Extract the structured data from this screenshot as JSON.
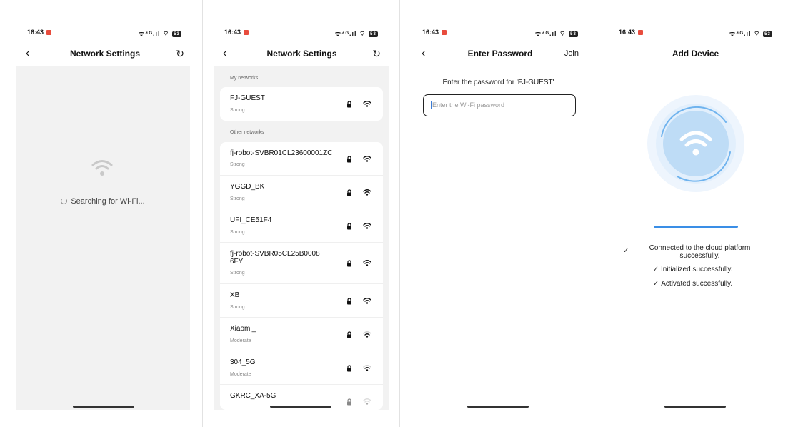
{
  "status_bar": {
    "time": "16:43",
    "system_icons": "ᯤ⁴ᴳ.ıl ⌔",
    "battery": "53"
  },
  "screen1": {
    "title": "Network Settings",
    "back_icon": "‹",
    "refresh_icon": "↻",
    "searching_text": "Searching for Wi-Fi..."
  },
  "screen2": {
    "title": "Network Settings",
    "back_icon": "‹",
    "refresh_icon": "↻",
    "my_networks_label": "My networks",
    "other_networks_label": "Other networks",
    "my_networks": [
      {
        "name": "FJ-GUEST",
        "strength": "Strong"
      }
    ],
    "other_networks": [
      {
        "name": "fj-robot-SVBR01CL23600001ZC",
        "strength": "Strong"
      },
      {
        "name": "YGGD_BK",
        "strength": "Strong"
      },
      {
        "name": "UFI_CE51F4",
        "strength": "Strong"
      },
      {
        "name": "fj-robot-SVBR05CL25B00086FY",
        "strength": "Strong"
      },
      {
        "name": "XB",
        "strength": "Strong"
      },
      {
        "name": "Xiaomi_",
        "strength": "Moderate"
      },
      {
        "name": "304_5G",
        "strength": "Moderate"
      },
      {
        "name": "GKRC_XA-5G",
        "strength": ""
      }
    ]
  },
  "screen3": {
    "title": "Enter Password",
    "back_icon": "‹",
    "join_label": "Join",
    "prompt": "Enter the password for 'FJ-GUEST'",
    "input_placeholder": "Enter the Wi-Fi password"
  },
  "screen4": {
    "title": "Add Device",
    "progress": 1.0,
    "steps": [
      "Connected to the cloud platform successfully.",
      "Initialized successfully.",
      "Activated successfully."
    ],
    "check_icon": "✓"
  },
  "colors": {
    "accent": "#3a8ee6",
    "panel_gray": "#f2f2f2",
    "notification": "#e84c3d"
  }
}
